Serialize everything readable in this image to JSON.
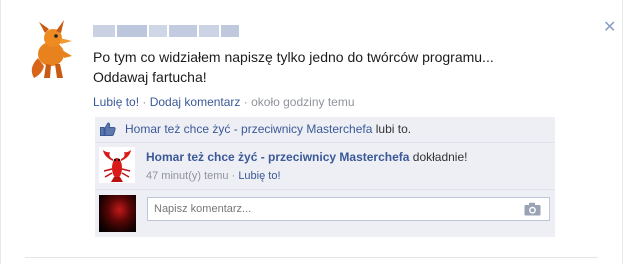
{
  "post": {
    "close_icon": "close-icon",
    "text_line1": "Po tym co widziałem napiszę tylko jedno do twórców programu...",
    "text_line2": "Oddawaj fartucha!",
    "like_link": "Lubię to!",
    "sep1": " · ",
    "comment_link": "Dodaj komentarz",
    "sep2": " · ",
    "timestamp": "około godziny temu"
  },
  "ufi": {
    "likes_page": "Homar też chce żyć - przeciwnicy Masterchefa",
    "likes_suffix": " lubi to.",
    "comment": {
      "author": "Homar też chce żyć - przeciwnicy Masterchefa",
      "text": " dokładnie!",
      "time": "47 minut(y) temu",
      "sep": " · ",
      "like_link": "Lubię to!"
    },
    "compose_placeholder": "Napisz komentarz..."
  },
  "colors": {
    "link": "#3b5998",
    "ufi_background": "#edeff4",
    "muted": "#90949c"
  }
}
